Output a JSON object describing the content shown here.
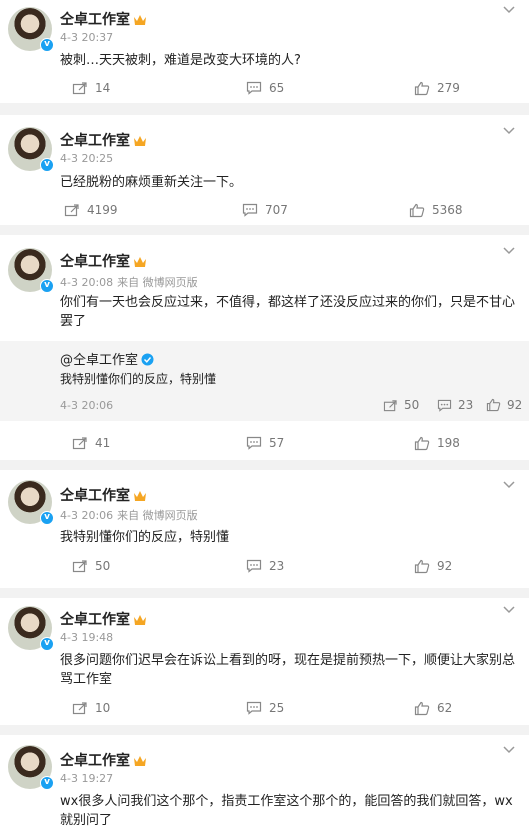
{
  "posts": [
    {
      "author": "仝卓工作室",
      "time": "4-3 20:37",
      "source": "",
      "text": "被刺…天天被刺，难道是改变大环境的人?",
      "reposts": "14",
      "comments": "65",
      "likes": "279"
    },
    {
      "author": "仝卓工作室",
      "time": "4-3 20:25",
      "source": "",
      "text": "已经脱粉的麻烦重新关注一下。",
      "reposts": "4199",
      "comments": "707",
      "likes": "5368"
    },
    {
      "author": "仝卓工作室",
      "time": "4-3 20:08",
      "source": "来自 微博网页版",
      "text": "你们有一天也会反应过来，不值得，都这样了还没反应过来的你们，只是不甘心罢了",
      "quote": {
        "author": "@仝卓工作室",
        "text": "我特别懂你们的反应，特别懂",
        "time": "4-3 20:06",
        "reposts": "50",
        "comments": "23",
        "likes": "92"
      },
      "reposts": "41",
      "comments": "57",
      "likes": "198"
    },
    {
      "author": "仝卓工作室",
      "time": "4-3 20:06",
      "source": "来自 微博网页版",
      "text": "我特别懂你们的反应，特别懂",
      "reposts": "50",
      "comments": "23",
      "likes": "92"
    },
    {
      "author": "仝卓工作室",
      "time": "4-3 19:48",
      "source": "",
      "text": "很多问题你们迟早会在诉讼上看到的呀，现在是提前预热一下，顺便让大家别总骂工作室",
      "reposts": "10",
      "comments": "25",
      "likes": "62"
    },
    {
      "author": "仝卓工作室",
      "time": "4-3 19:27",
      "source": "",
      "text": "wx很多人问我们这个那个，指责工作室这个那个的，能回答的我们就回答，wx就别问了"
    }
  ],
  "icons": {
    "repost": "repost-icon",
    "comment": "comment-icon",
    "like": "like-icon",
    "more": "chevron-down-icon",
    "verified": "verified-badge-icon",
    "crown": "crown-icon"
  },
  "colors": {
    "verified": "#1aa1f2",
    "crown": "#f5a623",
    "background": "#f2f2f2"
  }
}
